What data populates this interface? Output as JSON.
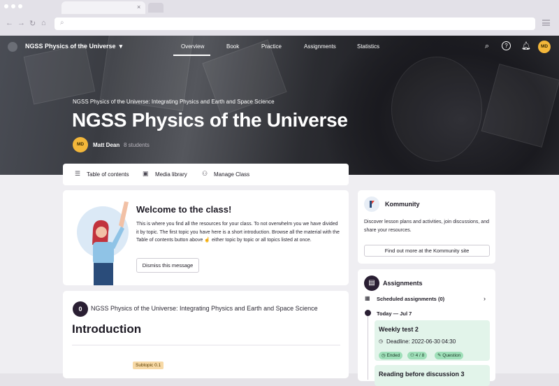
{
  "browser": {
    "tab_close": "×"
  },
  "header": {
    "brand": "NGSS Physics of the Universe",
    "nav": [
      "Overview",
      "Book",
      "Practice",
      "Assignments",
      "Statistics"
    ],
    "user_initials": "MD"
  },
  "hero": {
    "subtitle": "NGSS Physics of the Universe: Integrating Physics and Earth and Space Science",
    "title": "NGSS Physics of the Universe",
    "teacher_initials": "MD",
    "teacher_name": "Matt Dean",
    "student_count": "8 students"
  },
  "toolbar": {
    "toc": "Table of contents",
    "media": "Media library",
    "manage": "Manage Class"
  },
  "welcome": {
    "title": "Welcome to the class!",
    "body": "This is where you find all the resources for your class. To not overwhelm you we have divided it by topic. The first topic you have here is a short introduction. Browse all the material with the Table of contents button above ☝ either topic by topic or all topics listed at once.",
    "dismiss": "Dismiss this message"
  },
  "section": {
    "number": "0",
    "subtitle": "NGSS Physics of the Universe: Integrating Physics and Earth and Space Science",
    "title": "Introduction",
    "subtopic": "Subtopic 0.1"
  },
  "kommunity": {
    "title": "Kommunity",
    "body": "Discover lesson plans and activities, join discussions, and share your resources.",
    "button": "Find out more at the Kommunity site"
  },
  "assignments": {
    "title": "Assignments",
    "scheduled": "Scheduled assignments (0)",
    "today": "Today — Jul 7",
    "items": [
      {
        "title": "Weekly test 2",
        "deadline": "Deadline: 2022-06-30 04:30",
        "status": "Ended",
        "count": "4 / 8",
        "type": "Question"
      },
      {
        "title": "Reading before discussion 3"
      }
    ]
  },
  "colors": {
    "accent": "#f3b73a",
    "dark": "#2a1f33",
    "green": "#e2f4ea"
  }
}
